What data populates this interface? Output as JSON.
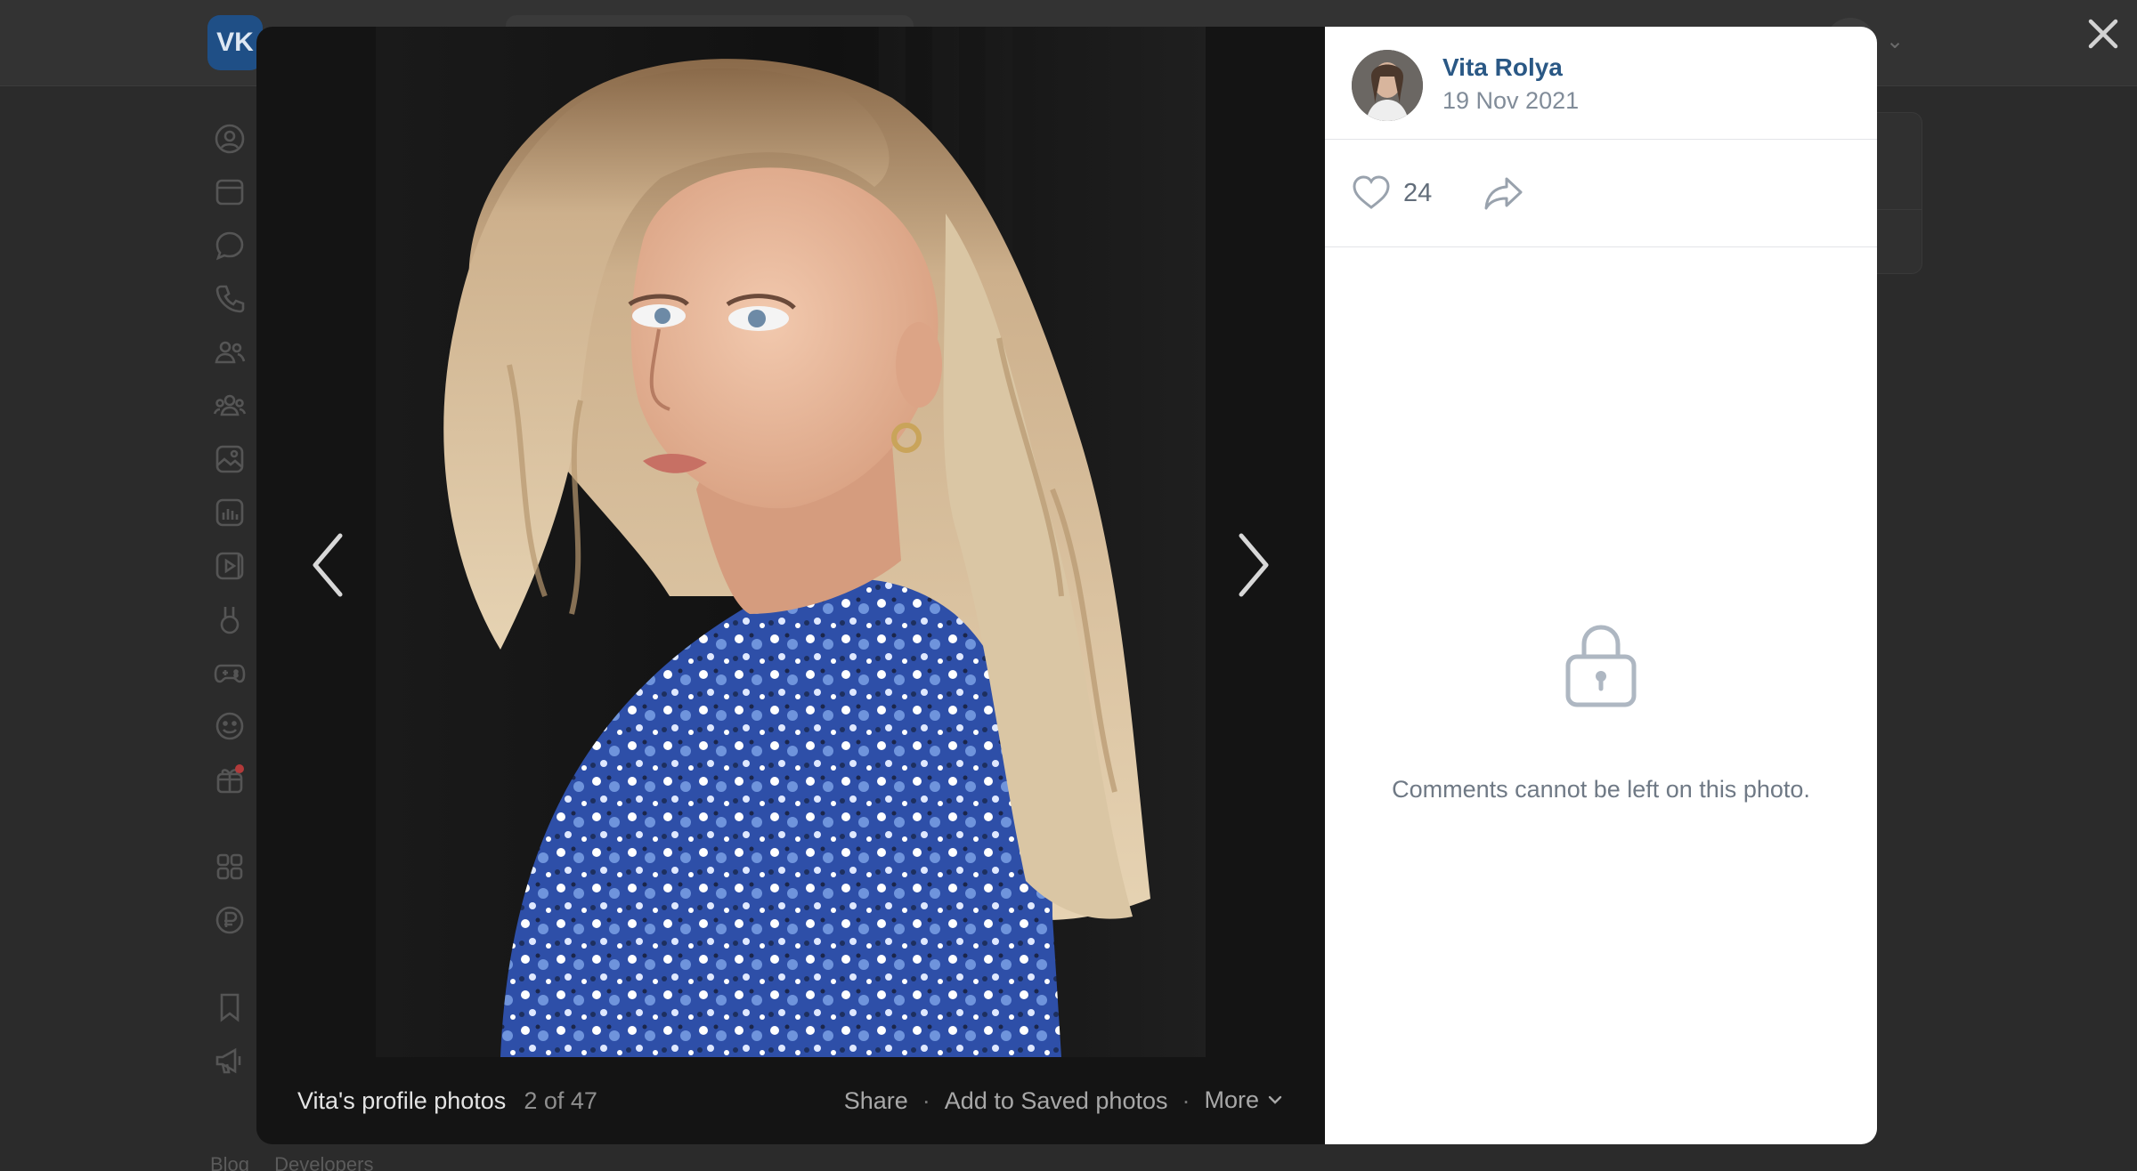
{
  "background": {
    "logo_text": "VK",
    "footer_links": [
      "Blog",
      "Developers"
    ],
    "sidebar_icons": [
      "profile-icon",
      "news-icon",
      "messenger-icon",
      "calls-icon",
      "friends-icon",
      "communities-icon",
      "photos-icon",
      "music-icon",
      "video-icon",
      "clips-icon",
      "games-icon",
      "stickers-icon",
      "gifts-icon",
      "services-icon",
      "vk-pay-icon",
      "bookmarks-icon",
      "advertising-icon"
    ]
  },
  "viewer": {
    "album_title": "Vita's profile photos",
    "counter": "2 of 47",
    "actions": {
      "share": "Share",
      "save": "Add to Saved photos",
      "more": "More"
    },
    "photo_description": "portrait photo"
  },
  "panel": {
    "author_name": "Vita Rolya",
    "date": "19 Nov 2021",
    "likes": "24",
    "comments_disabled_text": "Comments cannot be left on this photo."
  },
  "colors": {
    "accent_link": "#2a5885",
    "secondary_text": "#818c99",
    "overlay": "#2b2b2b",
    "photo_bg": "#141414"
  }
}
